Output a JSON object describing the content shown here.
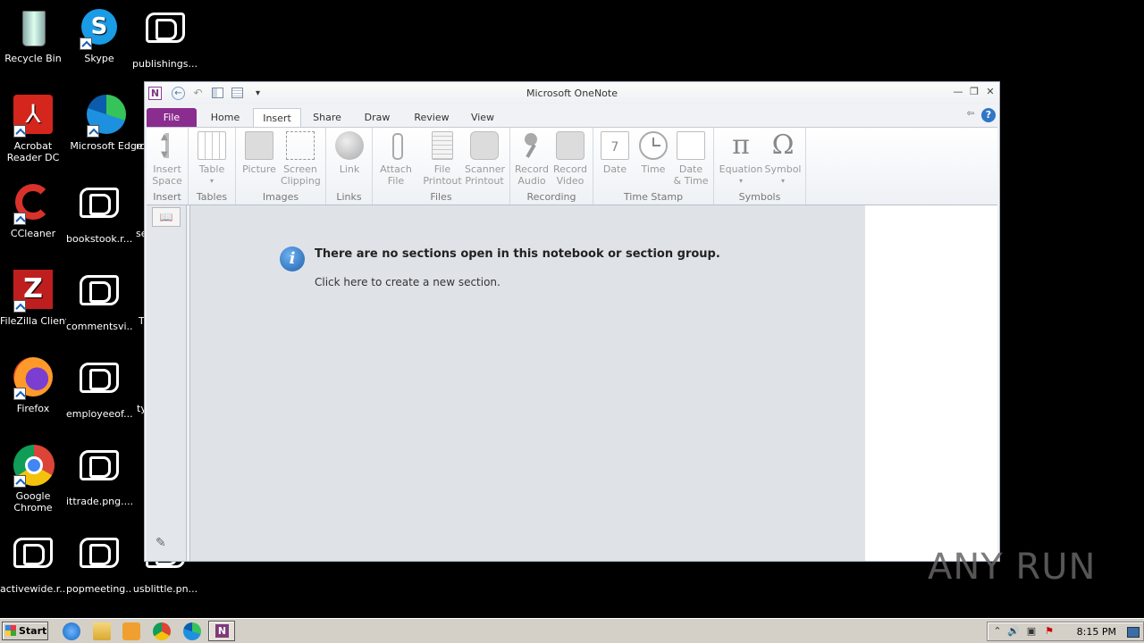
{
  "desktop": {
    "icons": [
      {
        "label": "Recycle Bin"
      },
      {
        "label": "Skype"
      },
      {
        "label": "publishings...."
      },
      {
        "label": "Acrobat Reader DC"
      },
      {
        "label": "Microsoft Edge"
      },
      {
        "label": "CCleaner"
      },
      {
        "label": "bookstook.r..."
      },
      {
        "label": "FileZilla Client"
      },
      {
        "label": "commentsvi..."
      },
      {
        "label": "Firefox"
      },
      {
        "label": "employeeof..."
      },
      {
        "label": "Google Chrome"
      },
      {
        "label": "ittrade.png...."
      },
      {
        "label": "activewide.r..."
      },
      {
        "label": "popmeeting...."
      },
      {
        "label": "usblittle.pn..."
      }
    ],
    "partial_labels": [
      "rc",
      "se",
      "T",
      "ty"
    ]
  },
  "window": {
    "title": "Microsoft OneNote",
    "qat": {
      "app_letter": "N",
      "back": "←",
      "undo": "↶",
      "dropdown": "▾"
    },
    "controls": {
      "minimize": "—",
      "restore": "❐",
      "close": "✕"
    },
    "tabs": [
      "File",
      "Home",
      "Insert",
      "Share",
      "Draw",
      "Review",
      "View"
    ],
    "help": "?",
    "ribbon": {
      "groups": [
        {
          "name": "Insert",
          "buttons": [
            {
              "line1": "Insert",
              "line2": "Space"
            }
          ]
        },
        {
          "name": "Tables",
          "buttons": [
            {
              "line1": "Table",
              "line2": "▾"
            }
          ]
        },
        {
          "name": "Images",
          "buttons": [
            {
              "line1": "Picture",
              "line2": ""
            },
            {
              "line1": "Screen",
              "line2": "Clipping"
            }
          ]
        },
        {
          "name": "Links",
          "buttons": [
            {
              "line1": "Link",
              "line2": ""
            }
          ]
        },
        {
          "name": "Files",
          "buttons": [
            {
              "line1": "Attach",
              "line2": "File"
            },
            {
              "line1": "File",
              "line2": "Printout"
            },
            {
              "line1": "Scanner",
              "line2": "Printout"
            }
          ]
        },
        {
          "name": "Recording",
          "buttons": [
            {
              "line1": "Record",
              "line2": "Audio"
            },
            {
              "line1": "Record",
              "line2": "Video"
            }
          ]
        },
        {
          "name": "Time Stamp",
          "buttons": [
            {
              "line1": "Date",
              "line2": ""
            },
            {
              "line1": "Time",
              "line2": ""
            },
            {
              "line1": "Date",
              "line2": "& Time"
            }
          ]
        },
        {
          "name": "Symbols",
          "buttons": [
            {
              "line1": "Equation",
              "line2": "▾",
              "glyph": "π"
            },
            {
              "line1": "Symbol",
              "line2": "▾",
              "glyph": "Ω"
            }
          ]
        }
      ]
    },
    "content": {
      "info_glyph": "i",
      "message": "There are no sections open in this notebook or section group.",
      "link": "Click here to create a new section."
    }
  },
  "watermark": "ANY RUN",
  "taskbar": {
    "start_label": "Start",
    "active_app_letter": "N",
    "clock": "8:15 PM"
  },
  "colors": {
    "file_tab": "#8a2d8e",
    "onenote_purple": "#80397b",
    "info_blue": "#1f5fae"
  }
}
